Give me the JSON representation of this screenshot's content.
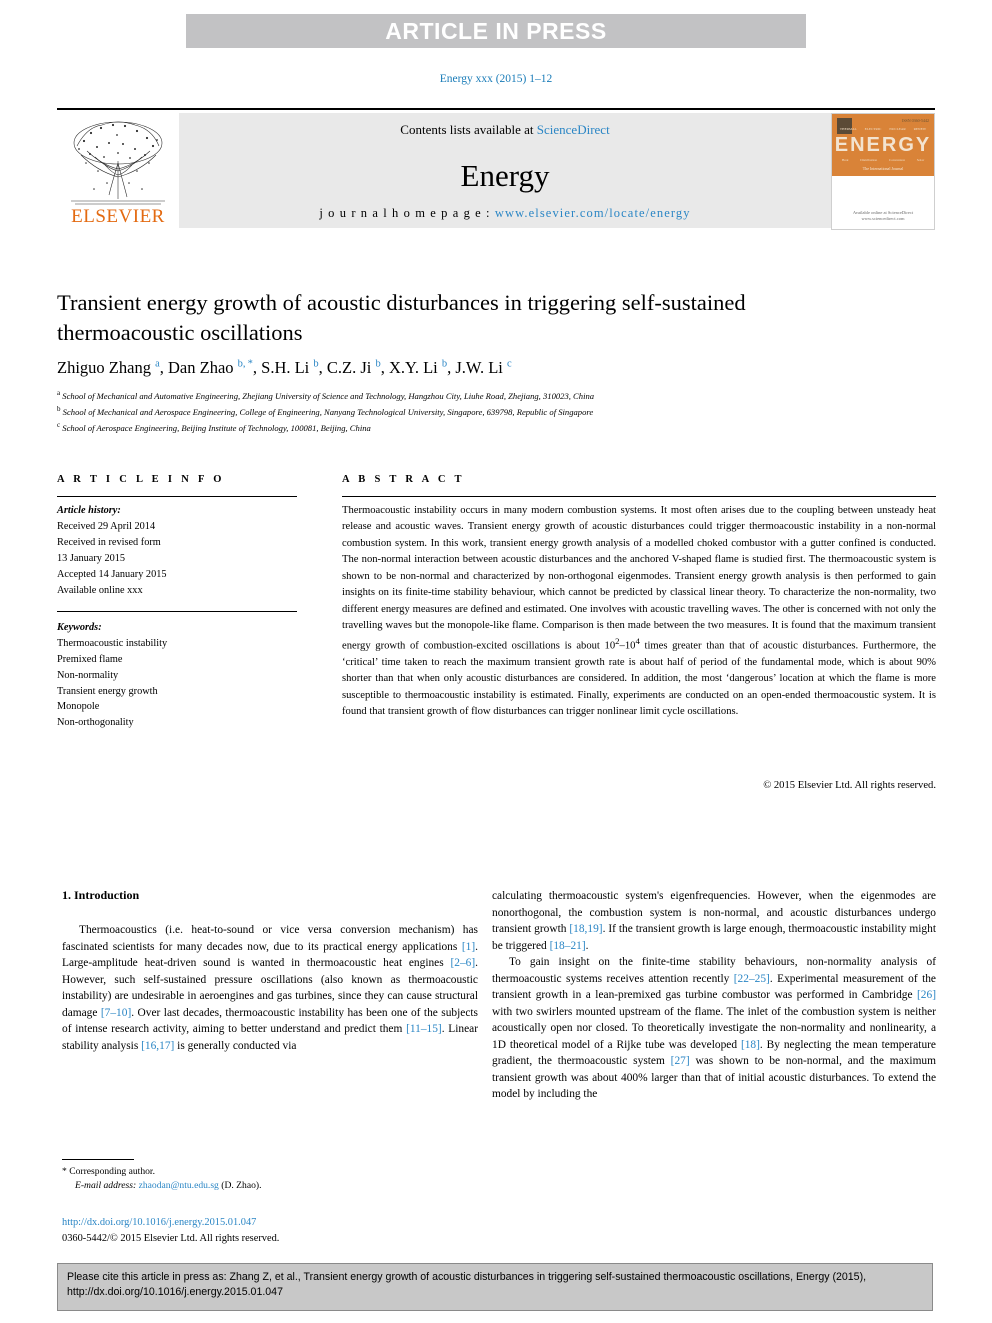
{
  "banner": {
    "text": "ARTICLE IN PRESS"
  },
  "journal_line": {
    "text": "Energy xxx (2015) 1–12"
  },
  "masthead": {
    "contents_prefix": "Contents lists available at ",
    "contents_link": "ScienceDirect",
    "journal_name": "Energy",
    "homepage_prefix": "j o u r n a l   h o m e p a g e :  ",
    "homepage_url": "www.elsevier.com/locate/energy",
    "publisher": "ELSEVIER",
    "cover": {
      "title": "ENERGY",
      "subtitle": "The International Journal",
      "top_note": "ISSN 0360-5442",
      "row_labels": [
        "THERMAL",
        "ELECTRIC",
        "NUCLEAR",
        "RENEW"
      ],
      "row_labels2": [
        "Heat",
        "Distribution",
        "Conversion",
        "Solar"
      ],
      "footer": "Available online at\nScienceDirect\nwww.sciencedirect.com"
    }
  },
  "article": {
    "title": "Transient energy growth of acoustic disturbances in triggering self-sustained thermoacoustic oscillations",
    "authors_html": "Zhiguo Zhang <sup>a</sup>, Dan Zhao <sup>b, *</sup>, S.H. Li <sup>b</sup>, C.Z. Ji <sup>b</sup>, X.Y. Li <sup>b</sup>, J.W. Li <sup>c</sup>",
    "affiliations": [
      {
        "mark": "a",
        "text": "School of Mechanical and Automative Engineering, Zhejiang University of Science and Technology, Hangzhou City, Liuhe Road, Zhejiang, 310023, China"
      },
      {
        "mark": "b",
        "text": "School of Mechanical and Aerospace Engineering, College of Engineering, Nanyang Technological University, Singapore, 639798, Republic of Singapore"
      },
      {
        "mark": "c",
        "text": "School of Aerospace Engineering, Beijing Institute of Technology, 100081, Beijing, China"
      }
    ]
  },
  "sections": {
    "article_info_heading": "A R T I C L E  I N F O",
    "abstract_heading": "A B S T R A C T"
  },
  "article_info": {
    "history_label": "Article history:",
    "history_lines": [
      "Received 29 April 2014",
      "Received in revised form",
      "13 January 2015",
      "Accepted 14 January 2015",
      "Available online xxx"
    ],
    "keywords_label": "Keywords:",
    "keywords": [
      "Thermoacoustic instability",
      "Premixed flame",
      "Non-normality",
      "Transient energy growth",
      "Monopole",
      "Non-orthogonality"
    ]
  },
  "abstract": {
    "text": "Thermoacoustic instability occurs in many modern combustion systems. It most often arises due to the coupling between unsteady heat release and acoustic waves. Transient energy growth of acoustic disturbances could trigger thermoacoustic instability in a non-normal combustion system. In this work, transient energy growth analysis of a modelled choked combustor with a gutter confined is conducted. The non-normal interaction between acoustic disturbances and the anchored V-shaped flame is studied first. The thermoacoustic system is shown to be non-normal and characterized by non-orthogonal eigenmodes. Transient energy growth analysis is then performed to gain insights on its finite-time stability behaviour, which cannot be predicted by classical linear theory. To characterize the non-normality, two different energy measures are defined and estimated. One involves with acoustic travelling waves. The other is concerned with not only the travelling waves but the monopole-like flame. Comparison is then made between the two measures. It is found that the maximum transient energy growth of combustion-excited oscillations is about 10²–10⁴ times greater than that of acoustic disturbances. Furthermore, the ‘critical’ time taken to reach the maximum transient growth rate is about half of period of the fundamental mode, which is about 90% shorter than that when only acoustic disturbances are considered. In addition, the most ‘dangerous’ location at which the flame is more susceptible to thermoacoustic instability is estimated. Finally, experiments are conducted on an open-ended thermoacoustic system. It is found that transient growth of flow disturbances can trigger nonlinear limit cycle oscillations.",
    "copyright": "© 2015 Elsevier Ltd. All rights reserved."
  },
  "body": {
    "section_number_title": "1. Introduction",
    "left_paragraph_1": "Thermoacoustics (i.e. heat-to-sound or vice versa conversion mechanism) has fascinated scientists for many decades now, due to its practical energy applications [1]. Large-amplitude heat-driven sound is wanted in thermoacoustic heat engines [2–6]. However, such self-sustained pressure oscillations (also known as thermoacoustic instability) are undesirable in aeroengines and gas turbines, since they can cause structural damage [7–10]. Over last decades, thermoacoustic instability has been one of the subjects of intense research activity, aiming to better understand and predict them [11–15]. Linear stability analysis [16,17] is generally conducted via",
    "right_paragraph_1": "calculating thermoacoustic system's eigenfrequencies. However, when the eigenmodes are nonorthogonal, the combustion system is non-normal, and acoustic disturbances undergo transient growth [18,19]. If the transient growth is large enough, thermoacoustic instability might be triggered [18–21].",
    "right_paragraph_2": "To gain insight on the finite-time stability behaviours, non-normality analysis of thermoacoustic systems receives attention recently [22–25]. Experimental measurement of the transient growth in a lean-premixed gas turbine combustor was performed in Cambridge [26] with two swirlers mounted upstream of the flame. The inlet of the combustion system is neither acoustically open nor closed. To theoretically investigate the non-normality and nonlinearity, a 1D theoretical model of a Rijke tube was developed [18]. By neglecting the mean temperature gradient, the thermoacoustic system [27] was shown to be non-normal, and the maximum transient growth was about 400% larger than that of initial acoustic disturbances. To extend the model by including the"
  },
  "footnote": {
    "corresponding": "* Corresponding author.",
    "email_label": "E-mail address:",
    "email": "zhaodan@ntu.edu.sg",
    "email_suffix": "(D. Zhao)."
  },
  "doi_block": {
    "doi_url": "http://dx.doi.org/10.1016/j.energy.2015.01.047",
    "issn_line": "0360-5442/© 2015 Elsevier Ltd. All rights reserved."
  },
  "citation_box": {
    "text": "Please cite this article in press as: Zhang Z, et al., Transient energy growth of acoustic disturbances in triggering self-sustained thermoacoustic oscillations, Energy (2015), http://dx.doi.org/10.1016/j.energy.2015.01.047"
  },
  "colors": {
    "link": "#2b86c5",
    "banner_bg": "#c2c2c4",
    "masthead_bg": "#e9e9e9",
    "elsevier_orange": "#e36a11",
    "citation_bg": "#c8c8c8"
  }
}
